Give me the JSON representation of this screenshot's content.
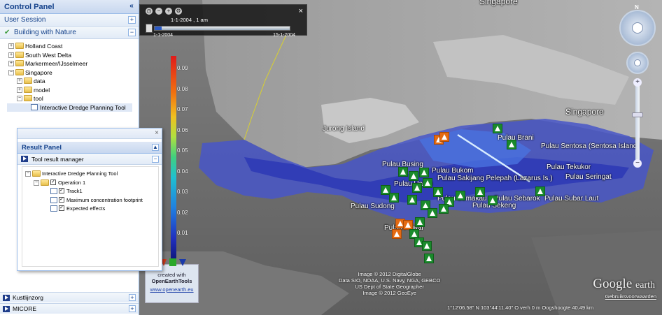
{
  "control_panel": {
    "title": "Control Panel",
    "collapse_glyph": "«",
    "user_session": "User Session",
    "user_session_toggle": "+",
    "project": "Building with Nature",
    "project_toggle": "−",
    "tree": [
      {
        "label": "Holland Coast",
        "toggle": "+"
      },
      {
        "label": "South West Delta",
        "toggle": "+"
      },
      {
        "label": "Markermeer/IJsselmeer",
        "toggle": "+"
      },
      {
        "label": "Singapore",
        "toggle": "−"
      },
      {
        "label": "data",
        "toggle": "+"
      },
      {
        "label": "model",
        "toggle": "+"
      },
      {
        "label": "tool",
        "toggle": "−"
      },
      {
        "label": "Interactive Dredge Planning Tool"
      }
    ],
    "bottom_items": [
      {
        "label": "Kustlijnzorg",
        "toggle": "+"
      },
      {
        "label": "MICORE",
        "toggle": "+"
      }
    ]
  },
  "result_panel": {
    "close_glyph": "×",
    "title": "Result Panel",
    "title_toggle": "▲",
    "manager": "Tool result manager",
    "manager_toggle": "−",
    "tree": [
      {
        "label": "Interactive Dredge Planning Tool",
        "toggle": "−"
      },
      {
        "label": "Operation 1",
        "toggle": "−",
        "checked": "✓"
      },
      {
        "label": "Track1",
        "checked": "✓"
      },
      {
        "label": "Maximum concentration footprint",
        "checked": "✓"
      },
      {
        "label": "Expected effects",
        "checked": "✓"
      }
    ]
  },
  "time_slider": {
    "current": "1-1-2004 , 1 am",
    "start": "1-1-2004",
    "end": "15-1-2004",
    "close_glyph": "×",
    "progress": 0.05
  },
  "legend": {
    "ticks": [
      "0.09",
      "0.08",
      "0.07",
      "0.06",
      "0.05",
      "0.04",
      "0.03",
      "0.02",
      "0.01"
    ],
    "credit_line1": "created with",
    "credit_line2": "OpenEarthTools",
    "credit_url": "www.openearth.eu"
  },
  "map": {
    "top_label": "Singapore",
    "labels": [
      {
        "text": "Jurong Island"
      },
      {
        "text": "Singapore"
      },
      {
        "text": "Pulau Brani"
      },
      {
        "text": "Pulau Sentosa (Sentosa Island)"
      },
      {
        "text": "Pulau Busing"
      },
      {
        "text": "Pulau Bukom"
      },
      {
        "text": "Pulau Hantu"
      },
      {
        "text": "Pulau Sakijang Pelepah (Lazarus Is.)"
      },
      {
        "text": "Pulau Tekukor"
      },
      {
        "text": "Pulau Seringat"
      },
      {
        "text": "Pulau Semakau"
      },
      {
        "text": "Pulau Sudong"
      },
      {
        "text": "Pulau Sekeng"
      },
      {
        "text": "Pulau Sebarok"
      },
      {
        "text": "Pulau Subar Laut"
      },
      {
        "text": "Pulau Pawai"
      }
    ],
    "credits": [
      "Image © 2012 DigitalGlobe",
      "Data SIO, NOAA, U.S. Navy, NGA, GEBCO",
      "US Dept of State Geographer",
      "Image © 2012 GeoEye"
    ],
    "logo_main": "Google",
    "logo_sub": "earth",
    "logo_link": "Gebruiksvoorwaarden",
    "status": "1°12'06.58\" N  103°44'11.40\" O  verh      0 m      Oogshoogte   40.49 km"
  },
  "nav": {
    "compass_n": "N",
    "zoom_in": "+",
    "zoom_out": "−"
  }
}
